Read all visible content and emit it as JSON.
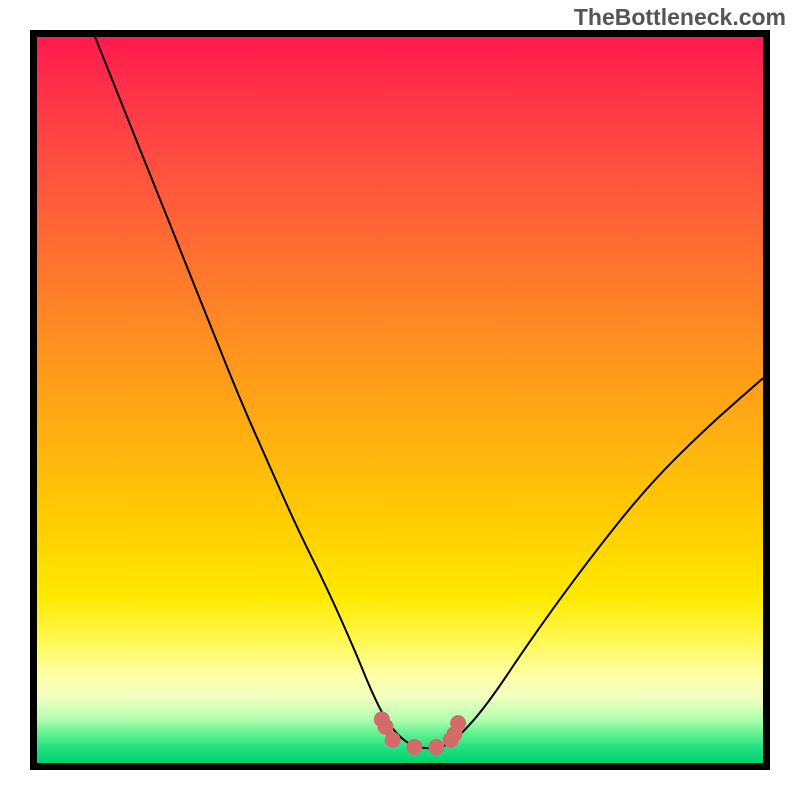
{
  "watermark": "TheBottleneck.com",
  "chart_data": {
    "type": "line",
    "title": "",
    "xlabel": "",
    "ylabel": "",
    "xlim": [
      0,
      100
    ],
    "ylim": [
      0,
      100
    ],
    "grid": false,
    "legend": false,
    "x": [
      8,
      12,
      16,
      20,
      24,
      28,
      32,
      36,
      40,
      44,
      46,
      48,
      50,
      52,
      54,
      56,
      58,
      62,
      68,
      76,
      84,
      92,
      100
    ],
    "values": [
      100,
      90,
      80,
      70,
      60,
      50,
      41,
      32,
      24,
      15,
      10,
      6,
      3.5,
      2.2,
      2.0,
      2.2,
      3.5,
      8,
      17,
      28,
      38,
      46,
      53
    ],
    "markers": {
      "x": [
        47.5,
        48.0,
        49.0,
        52.0,
        55.0,
        57.0,
        57.5,
        58.0
      ],
      "y": [
        6.0,
        5.0,
        3.2,
        2.2,
        2.2,
        3.2,
        4.0,
        5.5
      ],
      "color": "#d46a6a"
    },
    "gradient_stops": [
      {
        "pct": 0,
        "color": "#ff1a4d"
      },
      {
        "pct": 18,
        "color": "#ff5040"
      },
      {
        "pct": 42,
        "color": "#ff9020"
      },
      {
        "pct": 68,
        "color": "#ffd000"
      },
      {
        "pct": 88,
        "color": "#feffa8"
      },
      {
        "pct": 96,
        "color": "#60f090"
      },
      {
        "pct": 100,
        "color": "#00d070"
      }
    ]
  }
}
